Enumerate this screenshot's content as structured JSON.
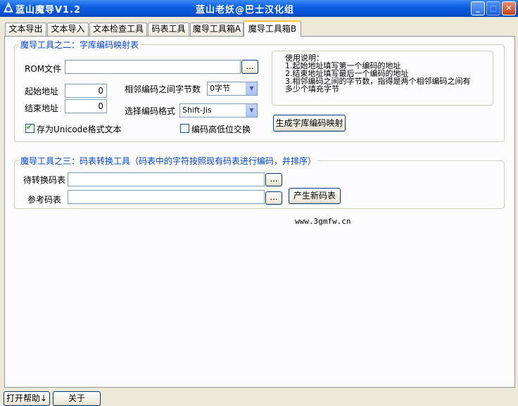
{
  "window": {
    "title": "蓝山魔导V1.2",
    "center_title": "蓝山老妖@巴士汉化组",
    "minimize_icon": "minimize-icon",
    "maximize_icon": "maximize-icon",
    "close_icon": "close-icon"
  },
  "tabs": [
    {
      "label": "文本导出"
    },
    {
      "label": "文本导入"
    },
    {
      "label": "文本检查工具"
    },
    {
      "label": "码表工具"
    },
    {
      "label": "魔导工具箱A"
    },
    {
      "label": "魔导工具箱B",
      "active": true
    }
  ],
  "group2": {
    "title": "魔导工具之二：字库编码映射表",
    "rom_label": "ROM文件",
    "rom_value": "",
    "browse_label": "...",
    "start_label": "起始地址",
    "start_value": "0",
    "end_label": "结束地址",
    "end_value": "0",
    "gap_label": "相邻编码之间字节数",
    "gap_value": "0字节",
    "format_label": "选择编码格式",
    "format_value": "Shift-Jis",
    "unicode_label": "存为Unicode格式文本",
    "unicode_checked": true,
    "swap_label": "编码高低位交换",
    "swap_checked": false,
    "generate_label": "生成字库编码映射",
    "notes": {
      "title": "使用说明：",
      "lines": [
        "1.起始地址填写第一个编码的地址",
        "2.结束地址填写最后一个编码的地址",
        "3.相邻编码之间的字节数，指得是两个相邻编码之间有",
        "多少个填充字节"
      ]
    }
  },
  "group3": {
    "title": "魔导工具之三：码表转换工具（码表中的字符按照现有码表进行编码，并排序）",
    "source_label": "待转换码表",
    "source_value": "",
    "ref_label": "参考码表",
    "ref_value": "",
    "browse_label": "...",
    "generate_label": "产生新码表"
  },
  "website": "www.3gmfw.cn",
  "bottom": {
    "help_label": "打开帮助↓",
    "about_label": "关于"
  },
  "colors": {
    "titlebar": "#0a5ce2",
    "group_title": "#0046d5",
    "face": "#ece9d8",
    "active_tab_accent": "#ffc83c"
  }
}
